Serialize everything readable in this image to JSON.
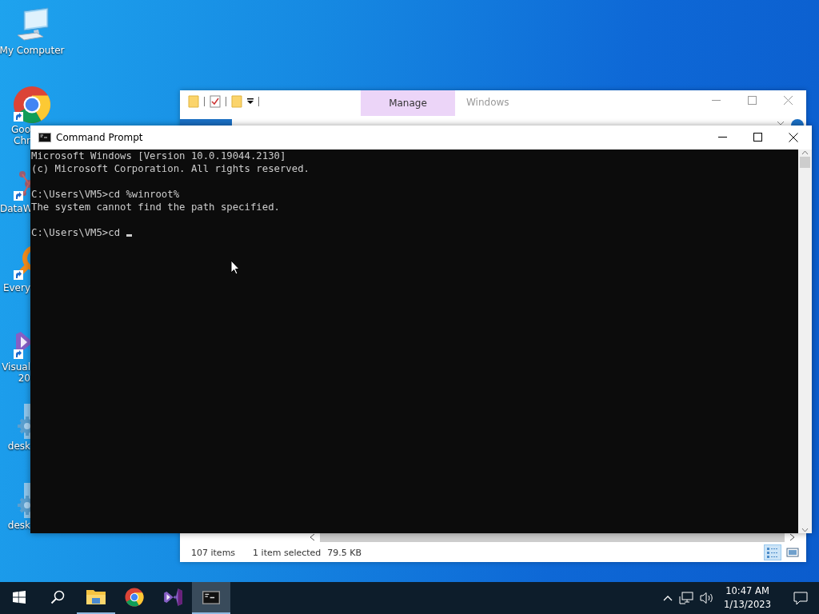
{
  "desktop": {
    "icons": [
      {
        "kind": "computer",
        "label_lines": [
          "My Computer"
        ]
      },
      {
        "kind": "chrome",
        "label_lines": [
          "Goo",
          "Chr"
        ]
      },
      {
        "kind": "datawarrior",
        "label_lines": [
          "DataW"
        ]
      },
      {
        "kind": "everything",
        "label_lines": [
          "Every"
        ]
      },
      {
        "kind": "visualstudio",
        "label_lines": [
          "Visual",
          "20"
        ]
      },
      {
        "kind": "settingsfile",
        "label_lines": [
          "desk"
        ]
      },
      {
        "kind": "settingsfile",
        "label_lines": [
          "desk"
        ]
      }
    ]
  },
  "explorer": {
    "context_tab": "Manage",
    "title": "Windows",
    "status": {
      "count": "107 items",
      "selection": "1 item selected",
      "size": "79.5 KB"
    },
    "views": [
      {
        "kind": "details",
        "selected": true
      },
      {
        "kind": "large",
        "selected": false
      }
    ]
  },
  "cmd": {
    "title": "Command Prompt",
    "blocks": [
      [
        "Microsoft Windows [Version 10.0.19044.2130]",
        "(c) Microsoft Corporation. All rights reserved."
      ],
      [
        "C:\\Users\\VM5>cd %winroot%",
        "The system cannot find the path specified."
      ],
      [
        "C:\\Users\\VM5>cd"
      ]
    ],
    "cursor": true
  },
  "taskbar": {
    "items": [
      {
        "kind": "start",
        "running": false,
        "selected": false
      },
      {
        "kind": "search",
        "running": false,
        "selected": false
      },
      {
        "kind": "explorer",
        "running": true,
        "selected": false
      },
      {
        "kind": "chrome",
        "running": false,
        "selected": false
      },
      {
        "kind": "visualstudio",
        "running": false,
        "selected": false
      },
      {
        "kind": "cmd",
        "running": true,
        "selected": true
      }
    ],
    "time": "10:47 AM",
    "date": "1/13/2023"
  }
}
